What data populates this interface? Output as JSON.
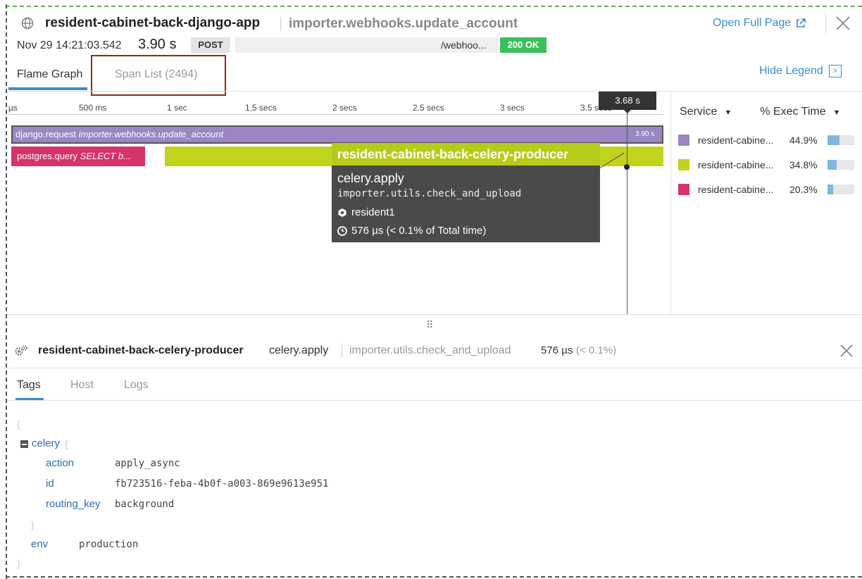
{
  "header": {
    "service": "resident-cabinet-back-django-app",
    "resource": "importer.webhooks.update_account",
    "open_full_page": "Open Full Page",
    "date": "Nov 29 14:21:03.542",
    "duration": "3.90 s",
    "method": "POST",
    "url": "/webhoo...",
    "status": "200 OK"
  },
  "tabs": {
    "flame_graph": "Flame Graph",
    "span_list": "Span List (2494)",
    "hide_legend": "Hide Legend"
  },
  "timeline": {
    "ticks": [
      "µs",
      "500 ms",
      "1 sec",
      "1.5 secs",
      "2 secs",
      "2.5 secs",
      "3 secs",
      "3.5 secs"
    ],
    "cursor_label": "3.68 s"
  },
  "spans": {
    "django": {
      "op": "django.request",
      "resource": "importer.webhooks.update_account",
      "duration": "3.90 s"
    },
    "postgres": {
      "op": "postgres.query",
      "resource": "SELECT b..."
    }
  },
  "tooltip": {
    "service": "resident-cabinet-back-celery-producer",
    "operation": "celery.apply",
    "resource": "importer.utils.check_and_upload",
    "host": "resident1",
    "time": "576 µs (< 0.1% of Total time)"
  },
  "legend": {
    "service_header": "Service",
    "exec_header": "% Exec Time",
    "rows": [
      {
        "name": "resident-cabine...",
        "pct": "44.9%",
        "color": "#9b85c3",
        "fill": 0.449
      },
      {
        "name": "resident-cabine...",
        "pct": "34.8%",
        "color": "#c2d31d",
        "fill": 0.348
      },
      {
        "name": "resident-cabine...",
        "pct": "20.3%",
        "color": "#d6336c",
        "fill": 0.203
      }
    ]
  },
  "detail": {
    "service": "resident-cabinet-back-celery-producer",
    "operation": "celery.apply",
    "resource": "importer.utils.check_and_upload",
    "duration": "576 µs",
    "pct": "(< 0.1%)",
    "tabs": [
      "Tags",
      "Host",
      "Logs"
    ],
    "json": {
      "open_brace": "{",
      "celery_key": "celery",
      "celery_open": "{",
      "action_key": "action",
      "action_val": "apply_async",
      "id_key": "id",
      "id_val": "fb723516-feba-4b0f-a003-869e9613e951",
      "routing_key": "routing_key",
      "routing_val": "background",
      "celery_close": "}",
      "env_key": "env",
      "env_val": "production",
      "close_brace": "}"
    }
  }
}
